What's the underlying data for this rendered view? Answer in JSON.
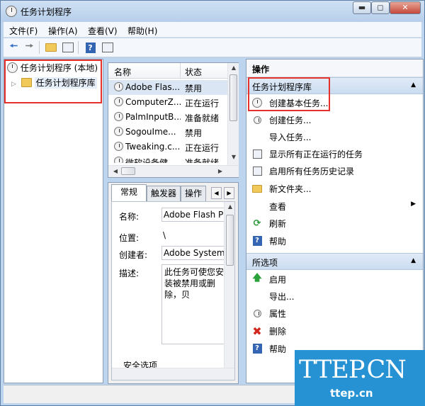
{
  "window": {
    "title": "任务计划程序",
    "min_label": "▭",
    "max_label": "◻",
    "close_label": "✕"
  },
  "menu": [
    "文件(F)",
    "操作(A)",
    "查看(V)",
    "帮助(H)"
  ],
  "tree": {
    "root": "任务计划程序 (本地)",
    "child": "任务计划程序库",
    "expander": "▷"
  },
  "list": {
    "headers": [
      "名称",
      "状态"
    ],
    "rows": [
      {
        "name": "Adobe Flas...",
        "status": "禁用"
      },
      {
        "name": "ComputerZ...",
        "status": "正在运行"
      },
      {
        "name": "PalmInputB...",
        "status": "准备就绪"
      },
      {
        "name": "SogouIme...",
        "status": "禁用"
      },
      {
        "name": "Tweaking.c...",
        "status": "正在运行"
      },
      {
        "name": "微软设备健...",
        "status": "准备就绪"
      }
    ]
  },
  "details": {
    "tabs": [
      "常规",
      "触发器",
      "操作"
    ],
    "name_label": "名称:",
    "name_value": "Adobe Flash Pla",
    "location_label": "位置:",
    "location_value": "\\",
    "author_label": "创建者:",
    "author_value": "Adobe Systems",
    "desc_label": "描述:",
    "desc_value": "此任务可使您安装被禁用或删除，贝",
    "security_label": "安全选项"
  },
  "actions": {
    "title": "操作",
    "section1": "任务计划程序库",
    "items1": [
      {
        "icon": "clock-icon",
        "label": "创建基本任务..."
      },
      {
        "icon": "task-icon",
        "label": "创建任务..."
      },
      {
        "icon": "none",
        "label": "导入任务..."
      },
      {
        "icon": "list-icon",
        "label": "显示所有正在运行的任务"
      },
      {
        "icon": "history-icon",
        "label": "启用所有任务历史记录"
      },
      {
        "icon": "folder-icon",
        "label": "新文件夹..."
      },
      {
        "icon": "none",
        "label": "查看"
      },
      {
        "icon": "refresh-icon",
        "label": "刷新"
      },
      {
        "icon": "help-icon",
        "label": "帮助"
      }
    ],
    "section2": "所选项",
    "items2": [
      {
        "icon": "run-icon",
        "label": "启用"
      },
      {
        "icon": "none",
        "label": "导出..."
      },
      {
        "icon": "properties-icon",
        "label": "属性"
      },
      {
        "icon": "delete-icon",
        "label": "删除"
      },
      {
        "icon": "help-icon",
        "label": "帮助"
      }
    ]
  },
  "watermark": {
    "big": "TTEP.CN",
    "small": "ttep.cn"
  },
  "colors": {
    "highlight_box": "#e4312b",
    "watermark_bg": "#2792d3",
    "section_header": "#cbdcf1"
  }
}
